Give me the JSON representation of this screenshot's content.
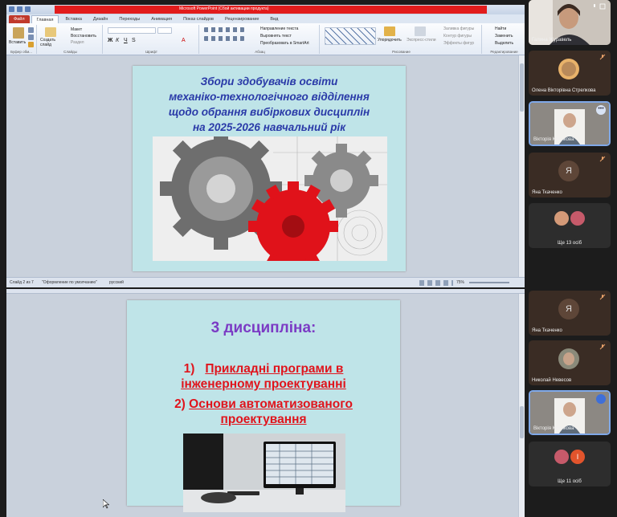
{
  "ppt_window": {
    "title": "Microsoft PowerPoint (Сбой активации продукта)",
    "tabs": [
      "Файл",
      "Главная",
      "Вставка",
      "Дизайн",
      "Переходы",
      "Анимация",
      "Показ слайдов",
      "Рецензирование",
      "Вид"
    ],
    "active_tab": "Главная",
    "ribbon": {
      "clipboard": {
        "paste": "Вставить",
        "group": "Буфер обм..."
      },
      "slides": {
        "new_slide": "Создать слайд",
        "layout": "Макет",
        "reset": "Восстановить",
        "section": "Раздел",
        "group": "Слайды"
      },
      "font": {
        "group": "Шрифт"
      },
      "paragraph": {
        "text_direction": "Направление текста",
        "align_text": "Выровнять текст",
        "smartart": "Преобразовать в SmartArt",
        "group": "Абзац"
      },
      "drawing": {
        "arrange": "Упорядочить",
        "quick_styles": "Экспресс-стили",
        "fill": "Заливка фигуры",
        "outline": "Контур фигуры",
        "effects": "Эффекты фигур",
        "group": "Рисование"
      },
      "editing": {
        "find": "Найти",
        "replace": "Заменить",
        "select": "Выделить",
        "group": "Редактирование"
      }
    },
    "statusbar": {
      "slide_info": "Слайд 2 из 7",
      "theme": "\"Оформление по умолчанию\"",
      "language": "русский",
      "zoom": "75%"
    }
  },
  "slide1": {
    "title_lines": [
      "Збори здобувачів освіти",
      "механіко-технологічного відділення",
      "щодо обрання вибіркових дисциплін",
      "на 2025-2026 навчальний рік"
    ]
  },
  "slide2": {
    "title": "3 дисципліна:",
    "item1": {
      "number": "1)",
      "text_line1": "Прикладні програми в",
      "text_line2": "інженерному проектуванні"
    },
    "item2": {
      "number": "2)",
      "text_line1": "Основи автоматизованого",
      "text_line2": "проектування"
    }
  },
  "participants": [
    {
      "name": "Галина Журавель",
      "muted": false
    },
    {
      "name": "Олена Вікторівна Стрелкова",
      "muted": true
    },
    {
      "name": "Вікторія Крючкова",
      "muted": false
    },
    {
      "name": "Яна Ткаченко",
      "initial": "Я",
      "muted": true
    },
    {
      "more_label": "Ще 13 осіб"
    },
    {
      "name": "Яна Ткаченко",
      "initial": "Я",
      "muted": true
    },
    {
      "name": "Николай Невесов",
      "muted": true
    },
    {
      "name": "Вікторія Крючкова",
      "muted": false
    },
    {
      "more_label": "Ще 11 осіб",
      "initial": "І"
    }
  ],
  "colors": {
    "slide_bg": "#bfe4e8",
    "slide1_title": "#2a3aa8",
    "slide2_title": "#7b3bc4",
    "slide2_items": "#e0141c",
    "tile_bg": "#3a2c24",
    "speaking_border": "#7fa8e8"
  }
}
